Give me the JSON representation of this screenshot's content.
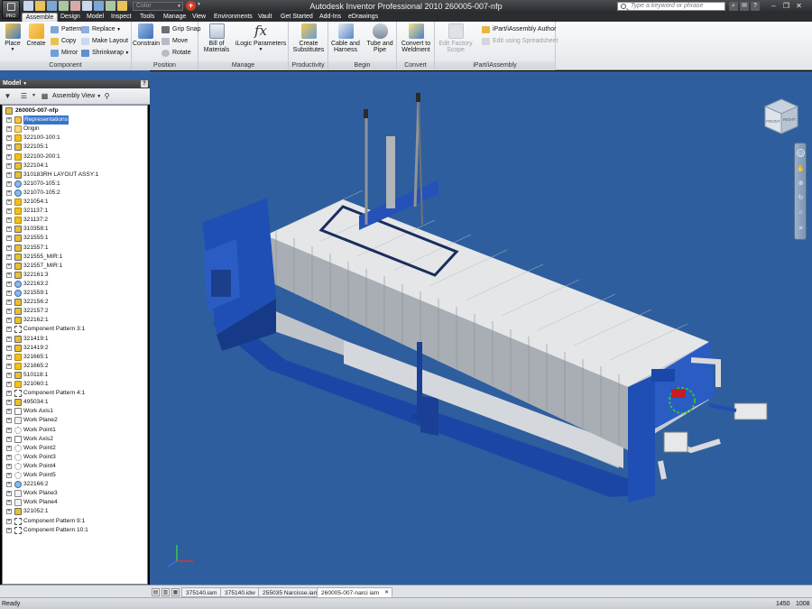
{
  "window": {
    "title": "Autodesk Inventor Professional 2010    260005-007-nfp",
    "app_button_label": "PRO",
    "color_selector": "Color",
    "search_placeholder": "Type a keyword or phrase"
  },
  "ribbon_tabs": [
    "Assemble",
    "Design",
    "Model",
    "Inspect",
    "Tools",
    "Manage",
    "View",
    "Environments",
    "Vault",
    "Get Started",
    "Add-Ins",
    "eDrawings"
  ],
  "ribbon": {
    "component": {
      "label": "Component",
      "place": "Place",
      "create": "Create",
      "pattern": "Pattern",
      "copy": "Copy",
      "mirror": "Mirror",
      "replace": "Replace",
      "make_layout": "Make Layout",
      "shrinkwrap": "Shrinkwrap"
    },
    "position": {
      "label": "Position",
      "constrain": "Constrain",
      "grip_snap": "Grip Snap",
      "move": "Move",
      "rotate": "Rotate"
    },
    "manage": {
      "label": "Manage",
      "bom_line1": "Bill of",
      "bom_line2": "Materials",
      "ilogic": "iLogic Parameters"
    },
    "productivity": {
      "label": "Productivity",
      "create_subs_line1": "Create",
      "create_subs_line2": "Substitutes"
    },
    "begin": {
      "label": "Begin",
      "cable_line1": "Cable and",
      "cable_line2": "Harness",
      "tube_line1": "Tube and",
      "tube_line2": "Pipe"
    },
    "convert": {
      "label": "Convert",
      "weld_line1": "Convert to",
      "weld_line2": "Weldment"
    },
    "ipart": {
      "label": "iPart/iAssembly",
      "factory_line1": "Edit Factory",
      "factory_line2": "Scope",
      "author": "iPart/iAssembly Author",
      "spreadsheet": "Edit using Spreadsheet"
    }
  },
  "model_panel": {
    "title": "Model",
    "view_label": "Assembly View",
    "tree": [
      {
        "label": "260005-007-nfp",
        "icon": "assembly-icon",
        "level": 0,
        "bold": true
      },
      {
        "label": "Representations",
        "icon": "representations-icon",
        "level": 1,
        "selected": true
      },
      {
        "label": "Origin",
        "icon": "origin-folder-icon",
        "level": 1
      },
      {
        "label": "322100-100:1",
        "icon": "part-icon",
        "level": 1
      },
      {
        "label": "322105:1",
        "icon": "subassembly-icon",
        "level": 1
      },
      {
        "label": "322100-200:1",
        "icon": "part-icon",
        "level": 1
      },
      {
        "label": "322104:1",
        "icon": "subassembly-icon",
        "level": 1
      },
      {
        "label": "310183RH LAYOUT ASSY:1",
        "icon": "subassembly-icon",
        "level": 1
      },
      {
        "label": "321070-105:1",
        "icon": "fastener-icon",
        "level": 1
      },
      {
        "label": "321070-105:2",
        "icon": "fastener-icon",
        "level": 1
      },
      {
        "label": "321054:1",
        "icon": "part-icon",
        "level": 1
      },
      {
        "label": "321137:1",
        "icon": "part-icon",
        "level": 1
      },
      {
        "label": "321137:2",
        "icon": "part-icon",
        "level": 1
      },
      {
        "label": "310358:1",
        "icon": "subassembly-icon",
        "level": 1
      },
      {
        "label": "321555:1",
        "icon": "subassembly-icon",
        "level": 1
      },
      {
        "label": "321557:1",
        "icon": "subassembly-icon",
        "level": 1
      },
      {
        "label": "321555_MIR:1",
        "icon": "subassembly-icon",
        "level": 1
      },
      {
        "label": "321557_MIR:1",
        "icon": "subassembly-icon",
        "level": 1
      },
      {
        "label": "322161:3",
        "icon": "subassembly-icon",
        "level": 1
      },
      {
        "label": "322163:2",
        "icon": "fastener-icon",
        "level": 1
      },
      {
        "label": "321559:1",
        "icon": "fastener-icon",
        "level": 1
      },
      {
        "label": "322156:2",
        "icon": "subassembly-icon",
        "level": 1
      },
      {
        "label": "322157:2",
        "icon": "subassembly-icon",
        "level": 1
      },
      {
        "label": "322162:1",
        "icon": "subassembly-icon",
        "level": 1
      },
      {
        "label": "Component Pattern 3:1",
        "icon": "pattern-icon",
        "level": 1
      },
      {
        "label": "321419:1",
        "icon": "subassembly-icon",
        "level": 1
      },
      {
        "label": "321419:2",
        "icon": "subassembly-icon",
        "level": 1
      },
      {
        "label": "321665:1",
        "icon": "part-icon",
        "level": 1
      },
      {
        "label": "321665:2",
        "icon": "part-icon",
        "level": 1
      },
      {
        "label": "510118:1",
        "icon": "subassembly-icon",
        "level": 1
      },
      {
        "label": "321060:1",
        "icon": "part-icon",
        "level": 1
      },
      {
        "label": "Component Pattern 4:1",
        "icon": "pattern-icon",
        "level": 1
      },
      {
        "label": "495034:1",
        "icon": "subassembly-icon",
        "level": 1
      },
      {
        "label": "Work Axis1",
        "icon": "work-axis-icon",
        "level": 1
      },
      {
        "label": "Work Plane2",
        "icon": "work-plane-icon",
        "level": 1
      },
      {
        "label": "Work Point1",
        "icon": "work-point-icon",
        "level": 1
      },
      {
        "label": "Work Axis2",
        "icon": "work-axis-icon",
        "level": 1
      },
      {
        "label": "Work Point2",
        "icon": "work-point-icon",
        "level": 1
      },
      {
        "label": "Work Point3",
        "icon": "work-point-icon",
        "level": 1
      },
      {
        "label": "Work Point4",
        "icon": "work-point-icon",
        "level": 1
      },
      {
        "label": "Work Point5",
        "icon": "work-point-icon",
        "level": 1
      },
      {
        "label": "322166:2",
        "icon": "fastener-icon",
        "level": 1
      },
      {
        "label": "Work Plane3",
        "icon": "work-plane-icon",
        "level": 1
      },
      {
        "label": "Work Plane4",
        "icon": "work-plane-icon",
        "level": 1
      },
      {
        "label": "321052:1",
        "icon": "subassembly-icon",
        "level": 1
      },
      {
        "label": "Component Pattern 9:1",
        "icon": "pattern-icon",
        "level": 1
      },
      {
        "label": "Component Pattern 10:1",
        "icon": "pattern-icon",
        "level": 1
      }
    ]
  },
  "viewcube": {
    "front": "FRONT",
    "right": "RIGHT"
  },
  "doc_tabs": [
    "375140.iam",
    "375140.idw",
    "255035 Narcisse.iam",
    "260005-007-narci  iam"
  ],
  "status": {
    "text": "Ready",
    "num1": "1450",
    "num2": "1008"
  },
  "colors": {
    "viewport_bg": "#2e5e9e",
    "machine_blue": "#1f4fb4",
    "plate_gray": "#d9dcdf"
  }
}
